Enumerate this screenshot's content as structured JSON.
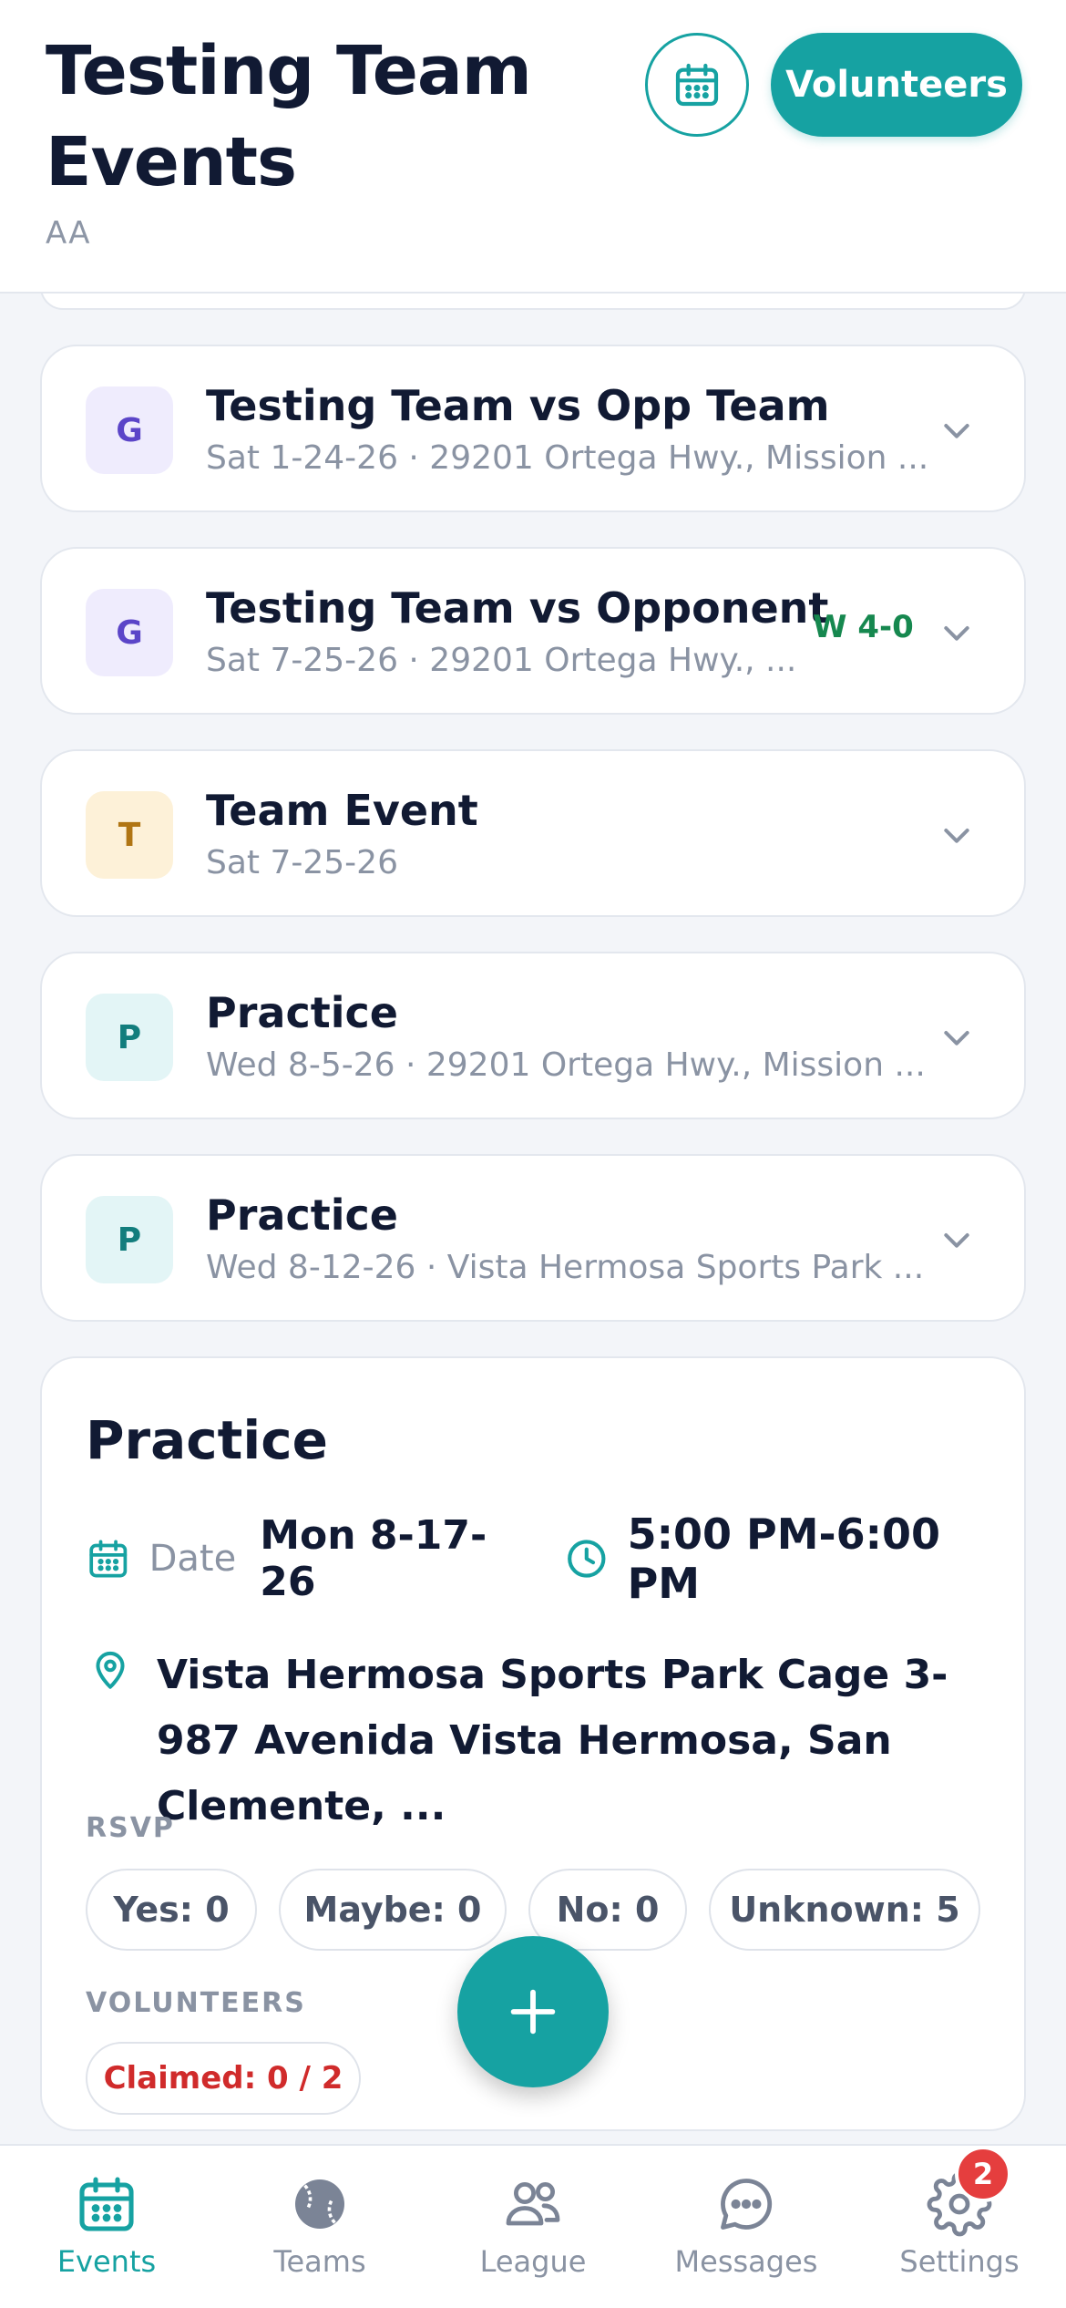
{
  "header": {
    "title": "Testing Team Events",
    "subtitle": "AA",
    "calendar_icon": "calendar-icon",
    "volunteers_label": "Volunteers"
  },
  "events": [
    {
      "badge": "G",
      "type": "game",
      "title": "Testing Team vs Opp Team",
      "subtitle": "Sat 1-24-26 · 29201 Ortega Hwy., Mission ...",
      "result": ""
    },
    {
      "badge": "G",
      "type": "game",
      "title": "Testing Team vs Opponent",
      "subtitle": "Sat 7-25-26 · 29201 Ortega Hwy., ...",
      "result": "W 4-0"
    },
    {
      "badge": "T",
      "type": "team",
      "title": "Team Event",
      "subtitle": "Sat 7-25-26",
      "result": ""
    },
    {
      "badge": "P",
      "type": "practice",
      "title": "Practice",
      "subtitle": "Wed 8-5-26 · 29201 Ortega Hwy., Mission ...",
      "result": ""
    },
    {
      "badge": "P",
      "type": "practice",
      "title": "Practice",
      "subtitle": "Wed 8-12-26 · Vista Hermosa Sports Park ...",
      "result": ""
    }
  ],
  "detail": {
    "title": "Practice",
    "date_label": "Date",
    "date": "Mon 8-17-26",
    "time": "5:00 PM-6:00 PM",
    "address": "Vista Hermosa Sports Park Cage 3- 987 Avenida Vista Hermosa, San Clemente, ...",
    "rsvp_label": "RSVP",
    "rsvp": {
      "yes": "Yes: 0",
      "maybe": "Maybe: 0",
      "no": "No: 0",
      "unknown": "Unknown: 5"
    },
    "volunteers_label": "VOLUNTEERS",
    "claimed": "Claimed: 0 / 2"
  },
  "tabs": [
    {
      "label": "Events",
      "icon": "calendar-icon",
      "active": true
    },
    {
      "label": "Teams",
      "icon": "baseball-icon",
      "active": false
    },
    {
      "label": "League",
      "icon": "people-icon",
      "active": false
    },
    {
      "label": "Messages",
      "icon": "chat-icon",
      "active": false
    },
    {
      "label": "Settings",
      "icon": "gear-icon",
      "active": false
    }
  ],
  "settings_badge": "2",
  "colors": {
    "accent": "#16a2a2",
    "win": "#16884f",
    "alert": "#d02b2b"
  }
}
